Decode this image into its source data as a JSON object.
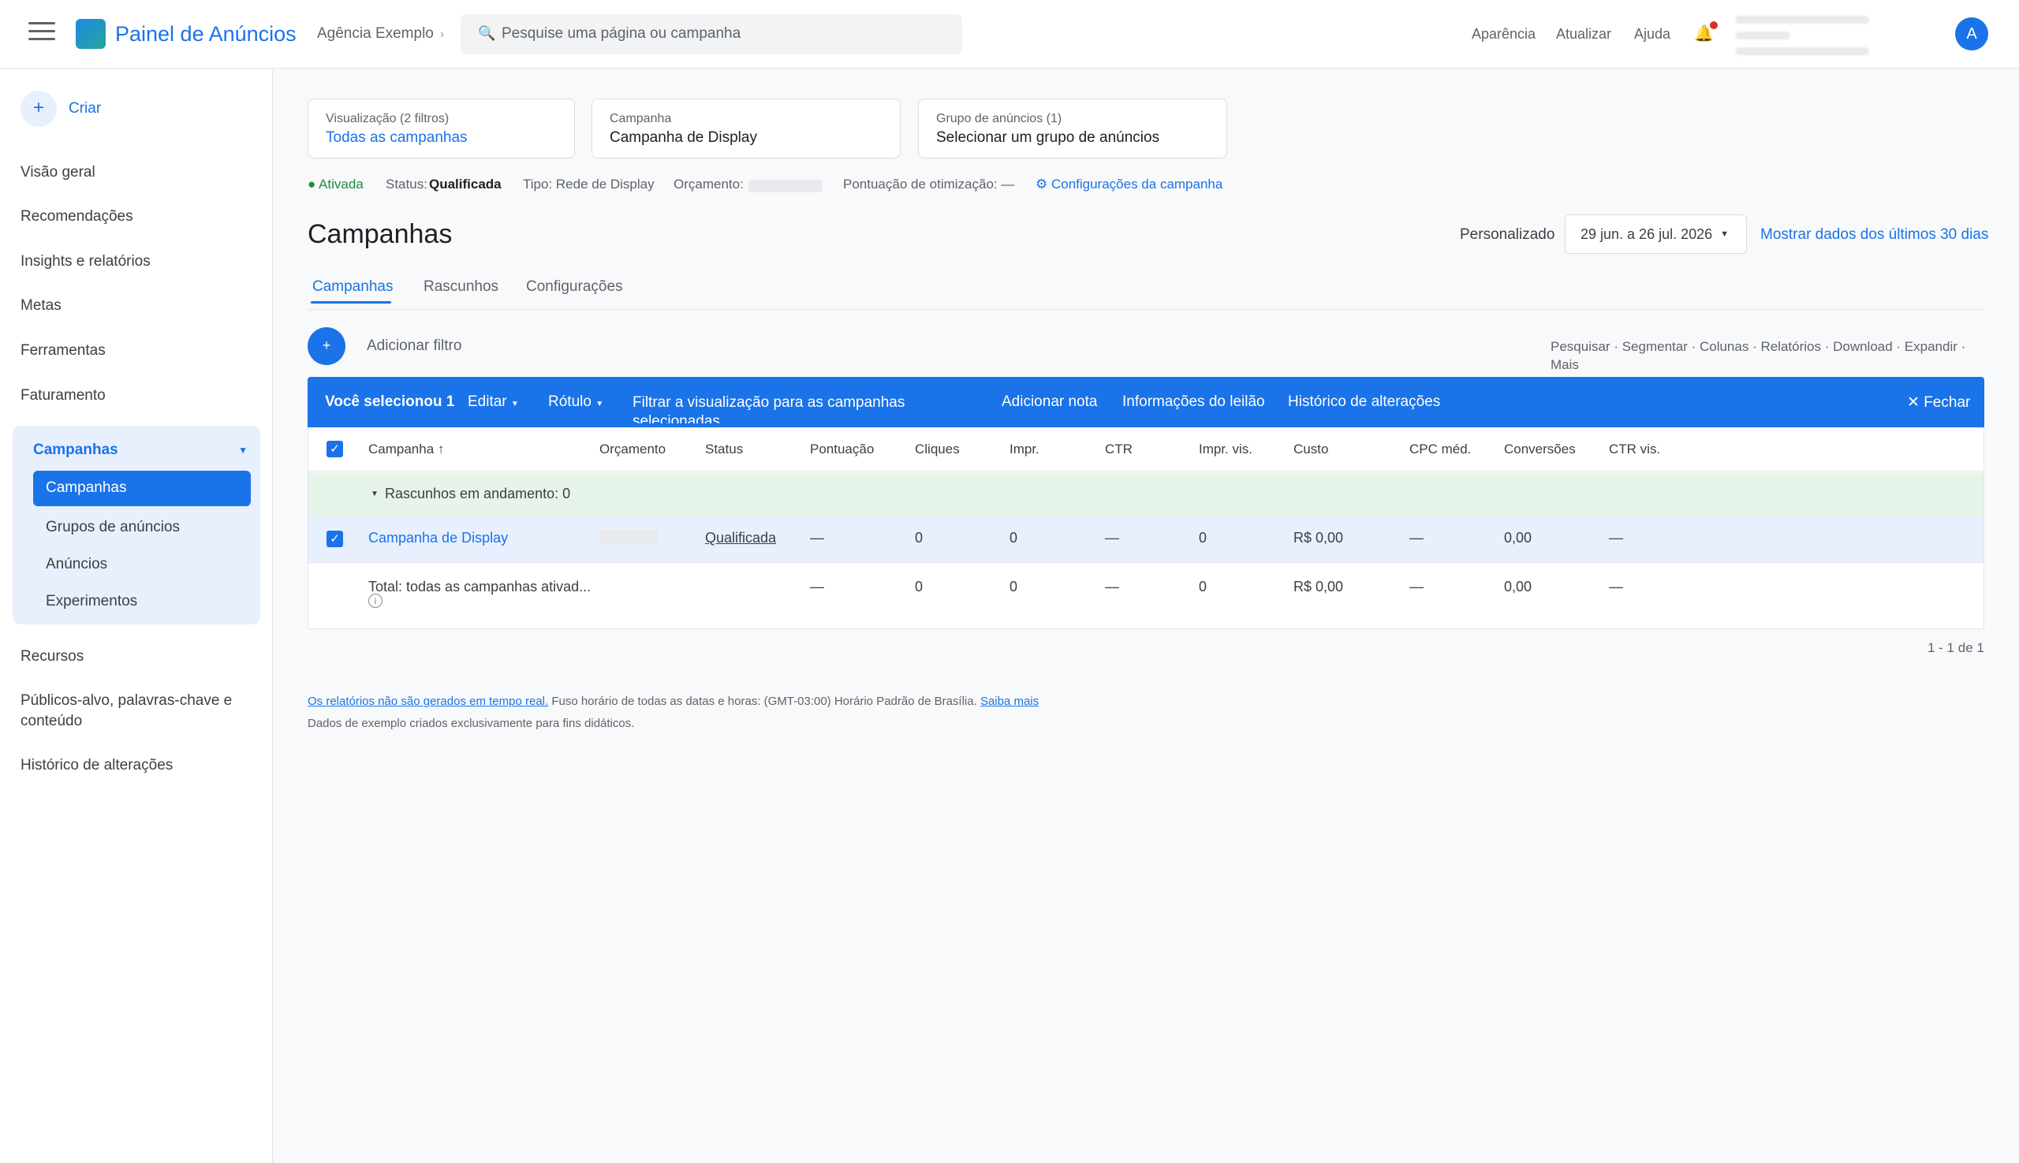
{
  "header": {
    "app_name": "Painel de Anúncios",
    "account": "Agência Exemplo",
    "account_chevron": "›",
    "search_placeholder": "Pesquise uma página ou campanha",
    "links": [
      "Aparência",
      "Atualizar",
      "Ajuda"
    ],
    "avatar_letter": "A",
    "brand_color": "#1a73e8"
  },
  "sidebar": {
    "create_label": "Criar",
    "items_top": [
      "Visão geral",
      "Recomendações",
      "Insights e relatórios",
      "Metas",
      "Ferramentas",
      "Faturamento"
    ],
    "group": {
      "title": "Campanhas",
      "active": "Campanhas",
      "subitems": [
        "Grupos de anúncios",
        "Anúncios",
        "Experimentos"
      ]
    },
    "items_bottom": [
      "Recursos",
      "Públicos-alvo, palavras-chave e conteúdo",
      "Histórico de alterações"
    ]
  },
  "filters": [
    {
      "label": "Visualização (2 filtros)",
      "value": "Todas as campanhas"
    },
    {
      "label": "Campanha",
      "value": "Campanha de Display"
    },
    {
      "label": "Grupo de anúncios (1)",
      "value": "Selecionar um grupo de anúncios"
    }
  ],
  "status_row": {
    "enabled": "● Ativada",
    "status_label": "Status:",
    "status_value": "Qualificada",
    "type": "Tipo: Rede de Display",
    "budget_label": "Orçamento:",
    "optimization": "Pontuação de otimização: —",
    "settings_link": "⚙ Configurações da campanha"
  },
  "page": {
    "title": "Campanhas",
    "range_label": "Personalizado",
    "date_range": "29 jun. a 26 jul. 2026",
    "last30_link": "Mostrar dados dos últimos 30 dias"
  },
  "tabs": [
    "Campanhas",
    "Rascunhos",
    "Configurações"
  ],
  "toolbar": {
    "add_filter": "Adicionar filtro",
    "links": "Pesquisar · Segmentar · Colunas · Relatórios · Download · Expandir · Mais"
  },
  "selection_bar": {
    "selected": "Você selecionou 1",
    "edit": "Editar",
    "label": "Rótulo",
    "filter_view": "Filtrar a visualização para as campanhas selecionadas",
    "add_note": "Adicionar nota",
    "auction_info": "Informações do leilão",
    "change_history": "Histórico de alterações",
    "close": "✕ Fechar"
  },
  "table": {
    "columns": [
      "Campanha ↑",
      "Orçamento",
      "Status",
      "Pontuação",
      "Cliques",
      "Impr.",
      "CTR",
      "Impr. vis.",
      "Custo",
      "CPC méd.",
      "Conversões",
      "CTR vis."
    ],
    "drafts_row": "Rascunhos em andamento: 0",
    "rows": [
      {
        "campaign": "Campanha de Display",
        "status": "Qualificada",
        "score": "—",
        "clicks": "0",
        "impr": "0",
        "ctr": "—",
        "viewable": "0",
        "cost": "R$ 0,00",
        "cpc": "—",
        "conversions": "0,00",
        "vctr": "—"
      }
    ],
    "total": {
      "label": "Total: todas as campanhas ativad...",
      "score": "—",
      "clicks": "0",
      "impr": "0",
      "ctr": "—",
      "viewable": "0",
      "cost": "R$ 0,00",
      "cpc": "—",
      "conversions": "0,00",
      "vctr": "—"
    },
    "pagination": "1 - 1 de 1"
  },
  "footer": {
    "not_realtime": "Os relatórios não são gerados em tempo real.",
    "timezone": " Fuso horário de todas as datas e horas: (GMT-03:00) Horário Padrão de Brasília. ",
    "learn_more": "Saiba mais",
    "note": "Dados de exemplo criados exclusivamente para fins didáticos."
  }
}
